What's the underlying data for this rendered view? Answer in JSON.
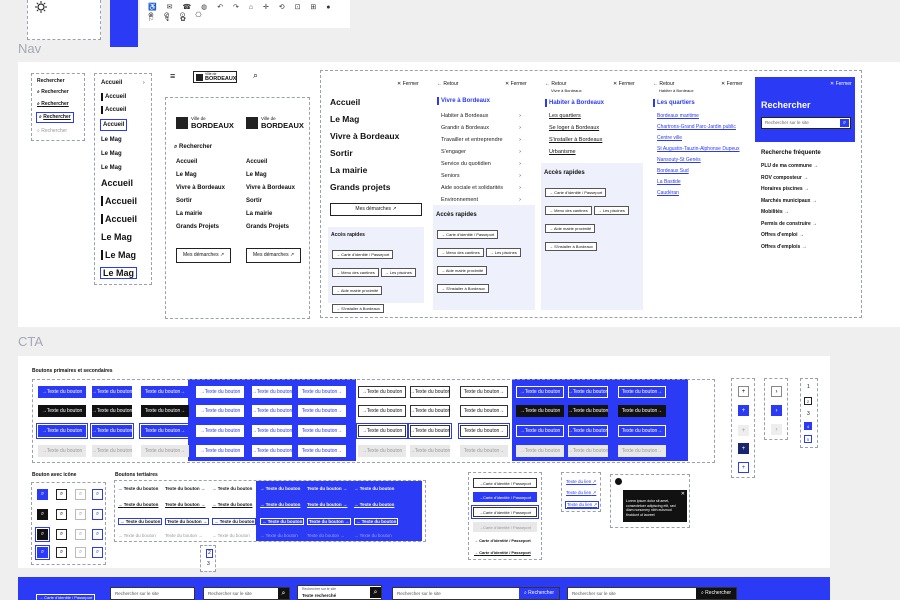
{
  "sections": {
    "nav": "Nav",
    "cta": "CTA"
  },
  "logo": {
    "small": "Ville de",
    "big": "BORDEAUX"
  },
  "search_col": [
    "Rechercher",
    "Rechercher",
    "Rechercher",
    "Rechercher",
    "Rechercher"
  ],
  "accueil_col": {
    "accueil": [
      "Accueil",
      "Accueil",
      "Accueil",
      "Accueil"
    ],
    "lemag_small": [
      "Le Mag",
      "Le Mag",
      "Le Mag"
    ],
    "accueil_big": [
      "Accueil",
      "Accueil",
      "Accueil"
    ],
    "lemag_big": [
      "Le Mag",
      "Le Mag",
      "Le Mag"
    ]
  },
  "mobile_nav": {
    "search": "Rechercher",
    "items": [
      "Accueil",
      "Le Mag",
      "Vivre à Bordeaux",
      "Sortir",
      "La mairie",
      "Grands Projets"
    ],
    "demarches": "Mes démarches"
  },
  "menu_main": {
    "close": "Fermer",
    "items": [
      "Accueil",
      "Le Mag",
      "Vivre à Bordeaux",
      "Sortir",
      "La mairie",
      "Grands projets"
    ],
    "demarches": "Mes démarches",
    "quick_title": "Accès rapides",
    "quick": [
      "Carte d'identité / Passeport",
      "Menu des cantines",
      "Les piscines",
      "Aide mairie proximité",
      "S'installer à Bordeaux"
    ]
  },
  "menu_vivre": {
    "back": "Retour",
    "close": "Fermer",
    "title": "Vivre à Bordeaux",
    "items": [
      "Habiter à Bordeaux",
      "Grandir à Bordeaux",
      "Travailler et entreprendre",
      "S'engager",
      "Service du quotidien",
      "Seniors",
      "Aide sociale et solidarités",
      "Environnement"
    ],
    "quick_title": "Accès rapides",
    "quick": [
      "Carte d'identité / Passeport",
      "Menu des cantines",
      "Les piscines",
      "Aide mairie proximité",
      "S'installer à Bordeaux"
    ]
  },
  "menu_habiter": {
    "back": "Retour",
    "crumb": "Vivre à Bordeaux",
    "close": "Fermer",
    "title": "Habiter à Bordeaux",
    "items": [
      "Les quartiers",
      "Se loger à Bordeaux",
      "S'installer à Bordeaux",
      "Urbanisme"
    ],
    "quick_title": "Accès rapides",
    "quick": [
      "Carte d'identité / Passeport",
      "Menu des cantines",
      "Les piscines",
      "Aide mairie proximité",
      "S'installer à Bordeaux"
    ]
  },
  "menu_quartiers": {
    "back": "Retour",
    "crumb": "Habiter à Bordeaux",
    "close": "Fermer",
    "title": "Les quartiers",
    "items": [
      "Bordeaux maritime",
      "Chartrons-Grand Parc-Jardin public",
      "Centre ville",
      "St Augustin-Tauzin-Alphonse Dupeux",
      "Nansouty-St Genès",
      "Bordeaux Sud",
      "La Bastide",
      "Caudéran"
    ]
  },
  "search_panel": {
    "close": "Fermer",
    "title": "Rechercher",
    "placeholder": "Rechercher sur le site",
    "freq_title": "Recherche fréquente",
    "freq": [
      "PLU de ma commune",
      "ROV composteur",
      "Horaires piscines",
      "Marchés municipaux",
      "Mobilités",
      "Permis de construire",
      "Offres d'emploi",
      "Offres d'emplois"
    ]
  },
  "cta": {
    "title_primary": "Boutons primaires et secondaires",
    "btn": "Texte du bouton",
    "title_icon": "Bouton avec icône",
    "title_tertiary": "Boutons tertiaires",
    "card_btn": "Carte d'identité / Passeport",
    "link": "Texte du lien",
    "tooltip": "Lorem ipsum dolor sit amet, consectetuer adipiscing elit, sed diam nonummy nibh euismod tincidunt ut laoreet",
    "pag": [
      "1",
      "2",
      "3",
      "4",
      "5"
    ],
    "pag2": [
      "2",
      "3"
    ]
  },
  "bottom": {
    "placeholder": "Rechercher sur le site",
    "typed_label": "Rechercher sur le site",
    "typed": "Texte recherché",
    "button": "Rechercher",
    "cta_small": "Carte d'identité / Passeport"
  },
  "colors": {
    "accent": "#2b3af5",
    "dark": "#111111",
    "bg": "#efefef"
  }
}
